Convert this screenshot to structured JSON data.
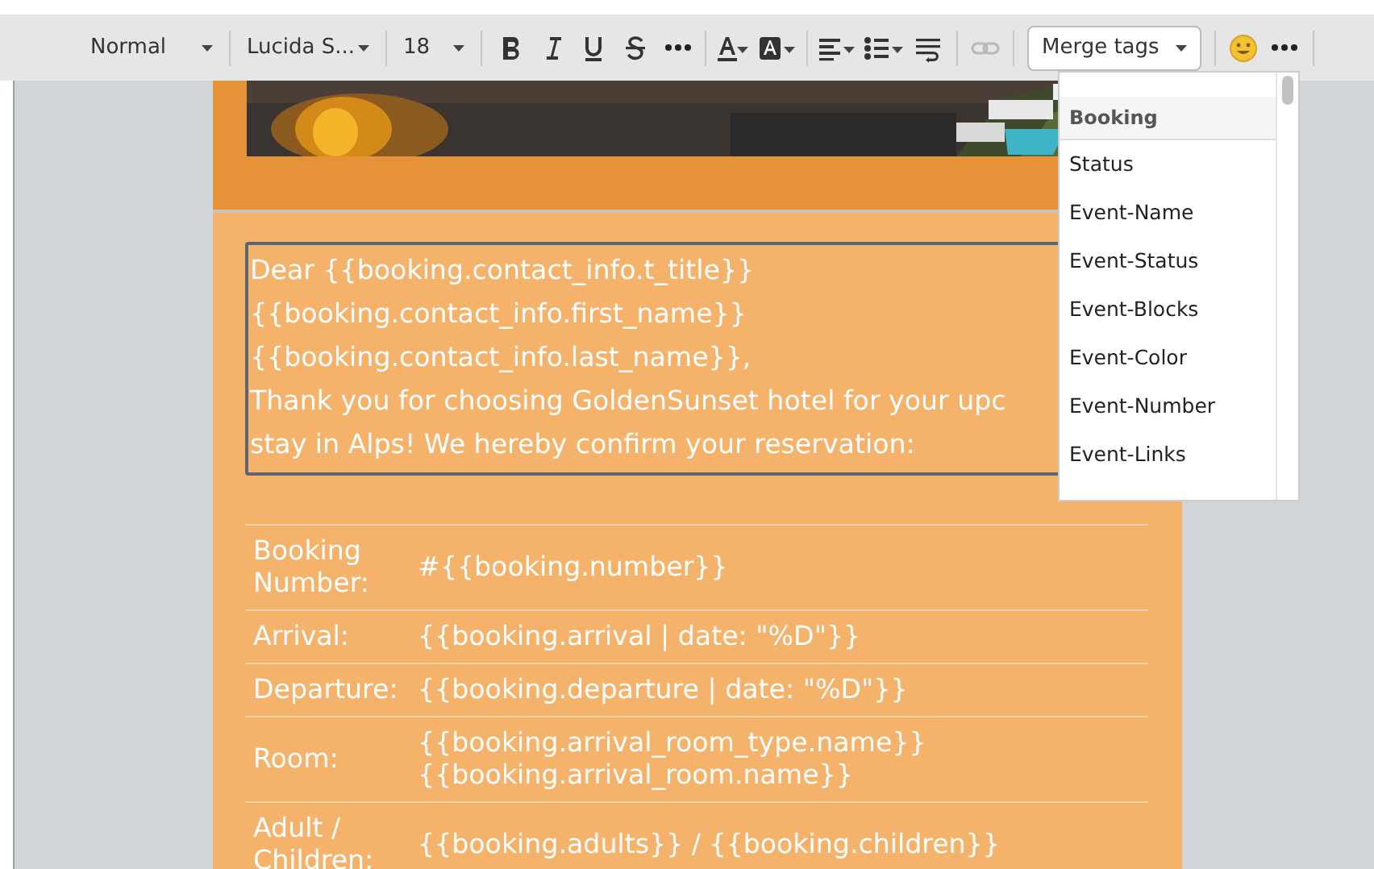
{
  "toolbar": {
    "style": "Normal",
    "font": "Lucida S...",
    "size": "18",
    "link_disabled": true,
    "merge_tags": {
      "label": "Merge tags",
      "expanded": true
    }
  },
  "greeting_lines": [
    "Dear {{booking.contact_info.t_title}}",
    "{{booking.contact_info.first_name}}",
    "{{booking.contact_info.last_name}},",
    "Thank you for choosing GoldenSunset hotel for your upc",
    "stay in Alps! We hereby confirm your reservation:"
  ],
  "details": [
    {
      "label": "Booking Number:",
      "values": [
        "#{{booking.number}}"
      ]
    },
    {
      "label": "Arrival:",
      "values": [
        "{{booking.arrival | date: \"%D\"}}"
      ]
    },
    {
      "label": "Departure:",
      "values": [
        "{{booking.departure | date: \"%D\"}}"
      ]
    },
    {
      "label": "Room:",
      "values": [
        "{{booking.arrival_room_type.name}}",
        "{{booking.arrival_room.name}}"
      ]
    },
    {
      "label": "Adult / Children:",
      "values": [
        "{{booking.adults}} / {{booking.children}}"
      ]
    }
  ],
  "merge_menu": {
    "group": "Booking",
    "items": [
      "Status",
      "Event-Name",
      "Event-Status",
      "Event-Blocks",
      "Event-Color",
      "Event-Number",
      "Event-Links"
    ]
  }
}
